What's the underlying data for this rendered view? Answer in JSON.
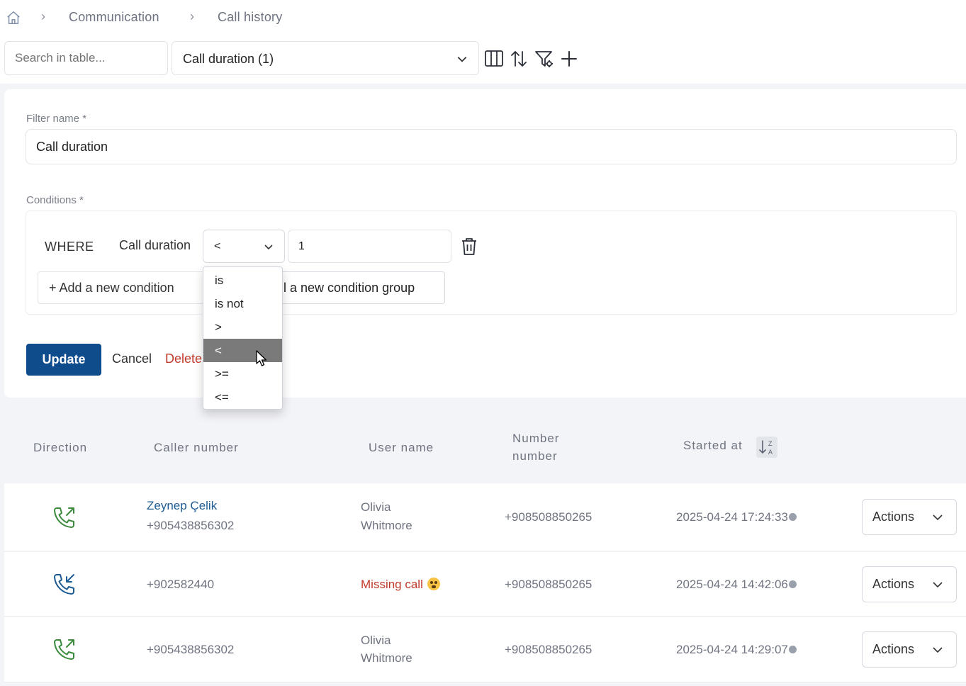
{
  "breadcrumb": {
    "items": [
      "Communication",
      "Call history"
    ]
  },
  "toolbar": {
    "search_placeholder": "Search in table...",
    "saved_filter": "Call duration (1)",
    "icons": [
      "columns-icon",
      "sort-icon",
      "filter-settings-icon",
      "add-icon"
    ]
  },
  "filter_form": {
    "name_label": "Filter name *",
    "name_value": "Call duration",
    "conditions_label": "Conditions *",
    "where": "WHERE",
    "condition_field": "Call duration",
    "operator": "<",
    "value": "1",
    "add_condition": "+ Add a new condition",
    "add_group": "+ Add a new condition group",
    "add_group_visible": "l a new condition group",
    "update": "Update",
    "cancel": "Cancel",
    "delete": "Delete",
    "delete_visible": "Delete"
  },
  "operator_menu": {
    "options": [
      "is",
      "is not",
      ">",
      "<",
      ">=",
      "<="
    ],
    "selected": "<"
  },
  "table": {
    "headers": {
      "direction": "Direction",
      "caller": "Caller number",
      "user": "User name",
      "number_l1": "Number",
      "number_l2": "number",
      "started": "Started at"
    },
    "sort_badge": "Z A",
    "rows": [
      {
        "direction": "outgoing",
        "caller_name": "Zeynep Çelik",
        "caller_number": "+905438856302",
        "user_l1": "Olivia",
        "user_l2": "Whitmore",
        "number": "+908508850265",
        "started": "2025-04-24 17:24:33",
        "actions": "Actions"
      },
      {
        "direction": "incoming",
        "caller_number": "+902582440",
        "user_missing": "Missing call",
        "number": "+908508850265",
        "started": "2025-04-24 14:42:06",
        "actions": "Actions"
      },
      {
        "direction": "outgoing",
        "caller_number": "+905438856302",
        "user_l1": "Olivia",
        "user_l2": "Whitmore",
        "number": "+908508850265",
        "started": "2025-04-24 14:29:07",
        "actions": "Actions"
      }
    ]
  },
  "colors": {
    "primary": "#0f4c8c",
    "link": "#1e5c94",
    "danger": "#c0392b",
    "outgoing_icon": "#3c8a3c",
    "incoming_icon": "#1e5c94",
    "menu_highlight": "#7a7a7a"
  }
}
